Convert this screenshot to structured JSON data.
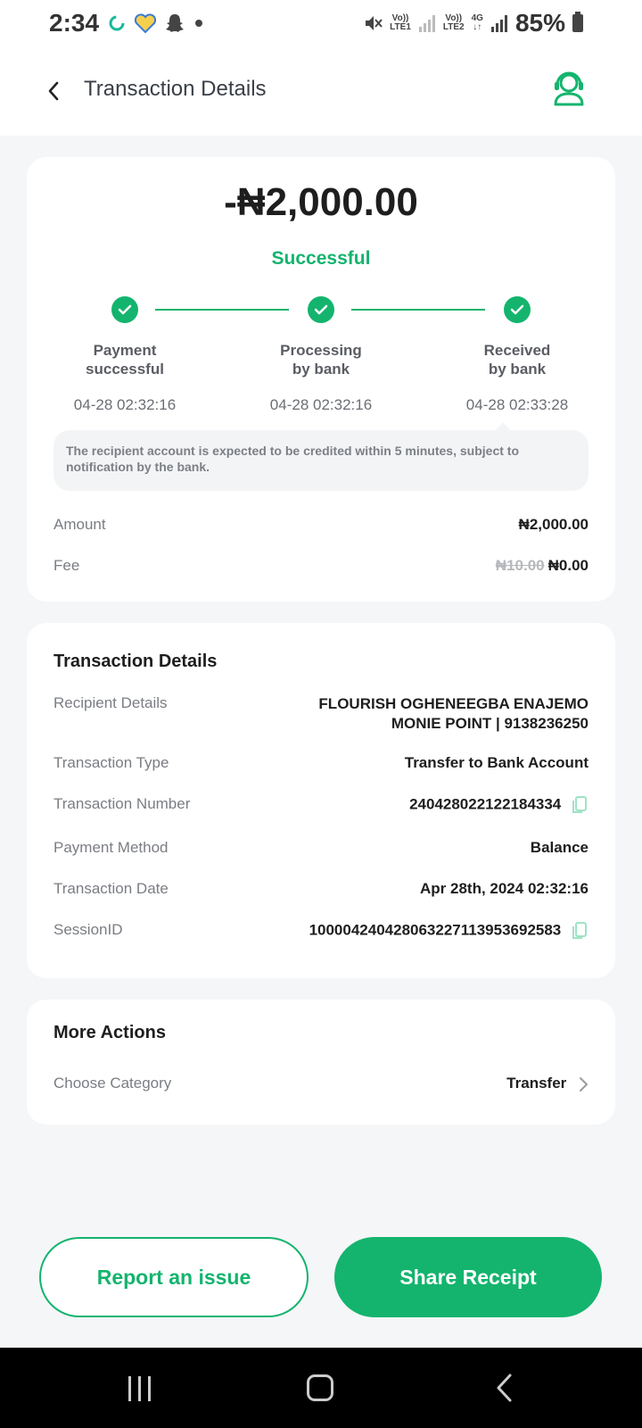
{
  "status_bar": {
    "time": "2:34",
    "net1_top": "Vo))",
    "net1_bottom": "LTE1",
    "net2_top": "Vo))",
    "net2_bottom": "LTE2",
    "net_type": "4G",
    "battery": "85%"
  },
  "header": {
    "title": "Transaction Details"
  },
  "summary": {
    "amount": "-₦2,000.00",
    "status": "Successful",
    "steps": [
      {
        "label_line1": "Payment",
        "label_line2": "successful",
        "time": "04-28 02:32:16"
      },
      {
        "label_line1": "Processing",
        "label_line2": "by bank",
        "time": "04-28 02:32:16"
      },
      {
        "label_line1": "Received",
        "label_line2": "by bank",
        "time": "04-28 02:33:28"
      }
    ],
    "note": "The recipient account is expected to be credited within 5 minutes, subject to notification by the bank.",
    "amount_label": "Amount",
    "amount_value": "₦2,000.00",
    "fee_label": "Fee",
    "fee_original": "₦10.00",
    "fee_value": "₦0.00"
  },
  "details": {
    "title": "Transaction Details",
    "recipient_label": "Recipient Details",
    "recipient_name": "FLOURISH OGHENEEGBA ENAJEMO",
    "recipient_bank": "MONIE POINT | 9138236250",
    "type_label": "Transaction Type",
    "type_value": "Transfer to Bank Account",
    "number_label": "Transaction Number",
    "number_value": "240428022122184334",
    "method_label": "Payment Method",
    "method_value": "Balance",
    "date_label": "Transaction Date",
    "date_value": "Apr 28th, 2024 02:32:16",
    "session_label": "SessionID",
    "session_value": "100004240428063227113953692583"
  },
  "more_actions": {
    "title": "More Actions",
    "category_label": "Choose Category",
    "category_value": "Transfer"
  },
  "buttons": {
    "report": "Report an issue",
    "share": "Share Receipt"
  },
  "colors": {
    "accent": "#14b46e",
    "background": "#f5f6f8"
  }
}
